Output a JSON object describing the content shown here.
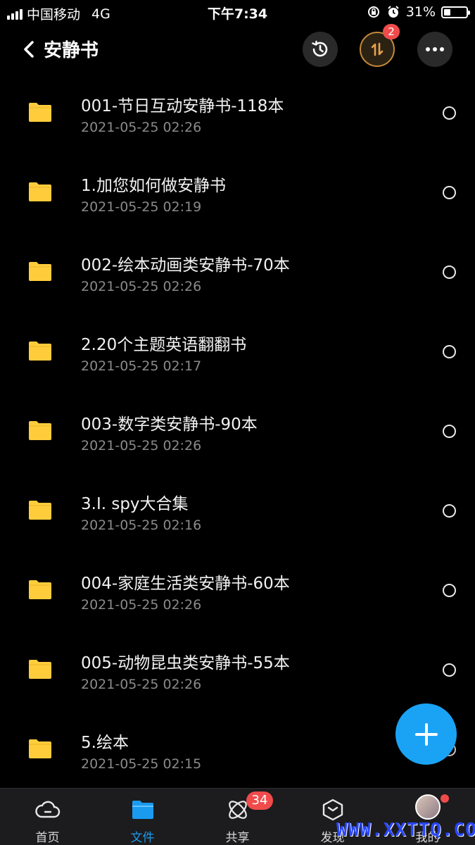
{
  "status_bar": {
    "carrier": "中国移动",
    "network": "4G",
    "time": "下午7:34",
    "battery": "31%"
  },
  "header": {
    "title": "安静书",
    "transfer_badge": "2",
    "icons": [
      "back-chevron-icon",
      "history-icon",
      "transfer-icon",
      "more-icon"
    ]
  },
  "files": [
    {
      "name": "001-节日互动安静书-118本",
      "date": "2021-05-25 02:26"
    },
    {
      "name": "1.加您如何做安静书",
      "date": "2021-05-25 02:19"
    },
    {
      "name": "002-绘本动画类安静书-70本",
      "date": "2021-05-25 02:26"
    },
    {
      "name": "2.20个主题英语翻翻书",
      "date": "2021-05-25 02:17"
    },
    {
      "name": "003-数字类安静书-90本",
      "date": "2021-05-25 02:26"
    },
    {
      "name": "3.I. spy大合集",
      "date": "2021-05-25 02:16"
    },
    {
      "name": "004-家庭生活类安静书-60本",
      "date": "2021-05-25 02:26"
    },
    {
      "name": "005-动物昆虫类安静书-55本",
      "date": "2021-05-25 02:26"
    },
    {
      "name": "5.绘本",
      "date": "2021-05-25 02:15"
    }
  ],
  "tabs": [
    {
      "label": "首页",
      "icon": "cloud-icon"
    },
    {
      "label": "文件",
      "icon": "folder-icon",
      "active": true
    },
    {
      "label": "共享",
      "icon": "share-orbit-icon",
      "badge": "34"
    },
    {
      "label": "发现",
      "icon": "discover-box-icon"
    },
    {
      "label": "我的",
      "icon": "avatar"
    }
  ],
  "watermark": "WWW.XXTTQ.COM",
  "colors": {
    "background": "#000000",
    "folder": "#ffcd3c",
    "accent": "#1a9bf0",
    "badge": "#f04b4b"
  }
}
